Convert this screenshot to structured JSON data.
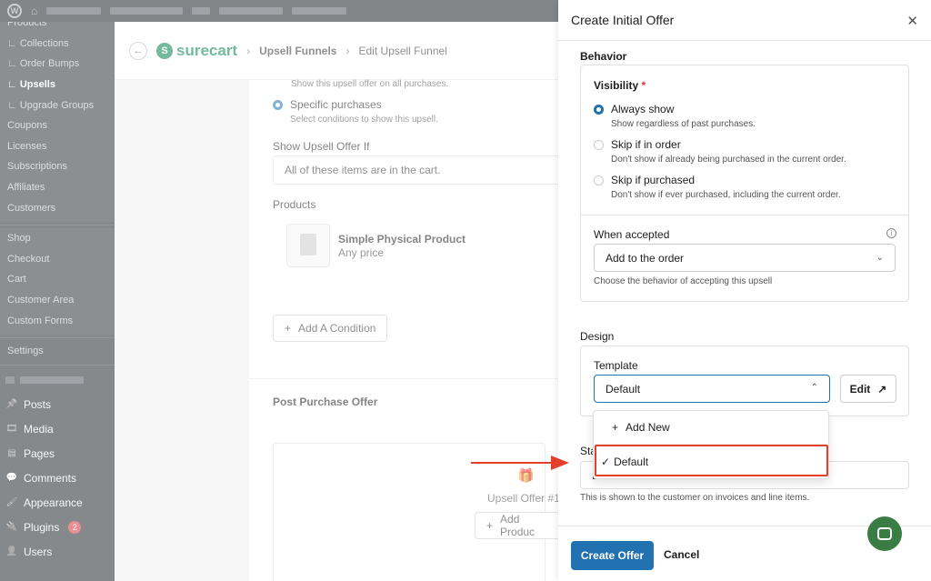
{
  "sidebar": {
    "submenu": [
      {
        "label": "Products",
        "current": false
      },
      {
        "label": "∟ Collections",
        "current": false
      },
      {
        "label": "∟ Order Bumps",
        "current": false
      },
      {
        "label": "∟ Upsells",
        "current": true
      },
      {
        "label": "∟ Upgrade Groups",
        "current": false
      },
      {
        "label": "Coupons",
        "current": false
      },
      {
        "label": "Licenses",
        "current": false
      },
      {
        "label": "Subscriptions",
        "current": false
      },
      {
        "label": "Affiliates",
        "current": false
      },
      {
        "label": "Customers",
        "current": false
      }
    ],
    "submenu2": [
      "Shop",
      "Checkout",
      "Cart",
      "Customer Area",
      "Custom Forms"
    ],
    "settings": "Settings",
    "main_items": [
      {
        "label": "Posts",
        "icon": "pin-icon"
      },
      {
        "label": "Media",
        "icon": "media-icon"
      },
      {
        "label": "Pages",
        "icon": "pages-icon"
      },
      {
        "label": "Comments",
        "icon": "comments-icon"
      },
      {
        "label": "Appearance",
        "icon": "brush-icon"
      },
      {
        "label": "Plugins",
        "icon": "plugin-icon",
        "badge": "2"
      },
      {
        "label": "Users",
        "icon": "users-icon"
      }
    ]
  },
  "header": {
    "brand": "surecart",
    "crumb1": "Upsell Funnels",
    "crumb2": "Edit Upsell Funnel"
  },
  "background": {
    "all_hint": "Show this upsell offer on all purchases.",
    "specific_label": "Specific purchases",
    "specific_hint": "Select conditions to show this upsell.",
    "show_if_label": "Show Upsell Offer If",
    "show_if_value": "All of these items are in the cart.",
    "products_label": "Products",
    "product_name": "Simple Physical Product",
    "product_price": "Any price",
    "add_condition": "Add A Condition",
    "post_purchase": "Post Purchase Offer",
    "upsell_offer": "Upsell Offer #1",
    "add_product": "Add Produc"
  },
  "drawer": {
    "title": "Create Initial Offer",
    "behavior_title": "Behavior",
    "visibility_label": "Visibility",
    "required_mark": "*",
    "options": [
      {
        "label": "Always show",
        "hint": "Show regardless of past purchases.",
        "selected": true
      },
      {
        "label": "Skip if in order",
        "hint": "Don't show if already being purchased in the current order.",
        "selected": false
      },
      {
        "label": "Skip if purchased",
        "hint": "Don't show if ever purchased, including the current order.",
        "selected": false
      }
    ],
    "when_accepted_label": "When accepted",
    "when_accepted_value": "Add to the order",
    "when_accepted_hint": "Choose the behavior of accepting this upsell",
    "design_title": "Design",
    "template_label": "Template",
    "template_value": "Default",
    "edit_label": "Edit",
    "dropdown": {
      "add_new": "Add New",
      "default": "Default",
      "default_check": "✓"
    },
    "statement_label_partial": "Sta",
    "statement_value_partial": "E",
    "statement_hint": "This is shown to the customer on invoices and line items.",
    "create_button": "Create Offer",
    "cancel_button": "Cancel"
  },
  "colors": {
    "primary": "#2271b1",
    "highlight": "#e2402a",
    "brand": "#01824c",
    "chat": "#3a7d44"
  }
}
